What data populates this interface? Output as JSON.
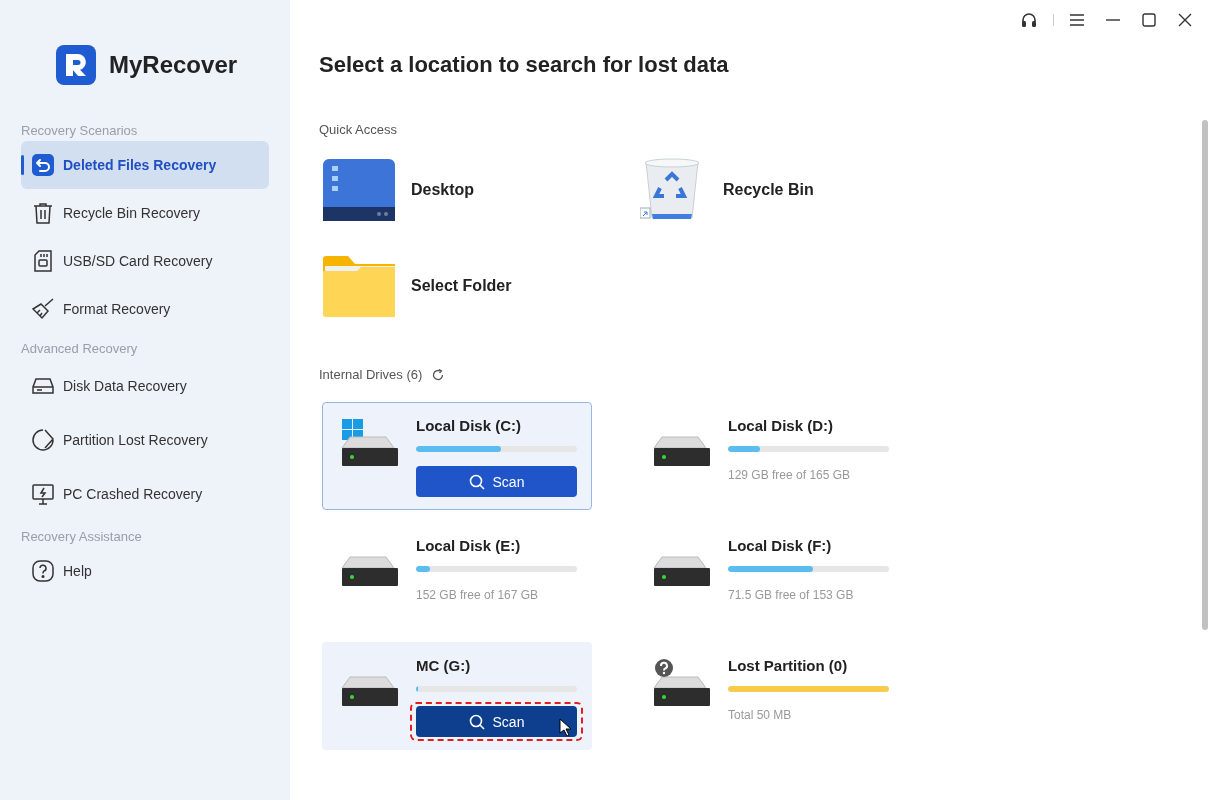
{
  "app": {
    "name": "MyRecover"
  },
  "sidebar": {
    "sections": [
      {
        "title": "Recovery Scenarios",
        "items": [
          {
            "label": "Deleted Files Recovery",
            "kind": "deleted",
            "selected": true
          },
          {
            "label": "Recycle Bin Recovery",
            "kind": "bin",
            "selected": false
          },
          {
            "label": "USB/SD Card Recovery",
            "kind": "sd",
            "selected": false
          },
          {
            "label": "Format Recovery",
            "kind": "broom",
            "selected": false
          }
        ]
      },
      {
        "title": "Advanced Recovery",
        "items": [
          {
            "label": "Disk Data Recovery",
            "kind": "disk",
            "selected": false
          },
          {
            "label": "Partition Lost Recovery",
            "kind": "partition",
            "selected": false
          },
          {
            "label": "PC Crashed Recovery",
            "kind": "pc",
            "selected": false
          }
        ]
      },
      {
        "title": "Recovery Assistance",
        "items": [
          {
            "label": "Help",
            "kind": "help",
            "selected": false
          }
        ]
      }
    ]
  },
  "page_title": "Select a location to search for lost data",
  "quick_access": {
    "title": "Quick Access",
    "items": [
      {
        "label": "Desktop",
        "kind": "desktop"
      },
      {
        "label": "Recycle Bin",
        "kind": "bin"
      },
      {
        "label": "Select Folder",
        "kind": "folder"
      }
    ]
  },
  "internal_drives": {
    "title": "Internal Drives (6)",
    "drives": [
      {
        "name": "Local Disk (C:)",
        "kind": "system",
        "level": 0.53,
        "color": "#5bbcf0",
        "selected": true,
        "hovered": false,
        "highlighted": false,
        "scan_label": "Scan"
      },
      {
        "name": "Local Disk (D:)",
        "kind": "disk",
        "level": 0.2,
        "color": "#5bbcf0",
        "selected": false,
        "hovered": false,
        "highlighted": false,
        "detail": "129 GB free of 165 GB"
      },
      {
        "name": "Local Disk (E:)",
        "kind": "disk",
        "level": 0.09,
        "color": "#5bbcf0",
        "selected": false,
        "hovered": false,
        "highlighted": false,
        "detail": "152 GB free of 167 GB"
      },
      {
        "name": "Local Disk (F:)",
        "kind": "disk",
        "level": 0.53,
        "color": "#5bbcf0",
        "selected": false,
        "hovered": false,
        "highlighted": false,
        "detail": "71.5 GB free of 153 GB"
      },
      {
        "name": "MC (G:)",
        "kind": "disk",
        "level": 0.01,
        "color": "#5bbcf0",
        "selected": false,
        "hovered": true,
        "highlighted": true,
        "scan_label": "Scan"
      },
      {
        "name": "Lost Partition (0)",
        "kind": "lost",
        "level": 1,
        "color": "#f7cc4a",
        "selected": false,
        "hovered": false,
        "highlighted": false,
        "detail": "Total 50 MB"
      }
    ]
  }
}
